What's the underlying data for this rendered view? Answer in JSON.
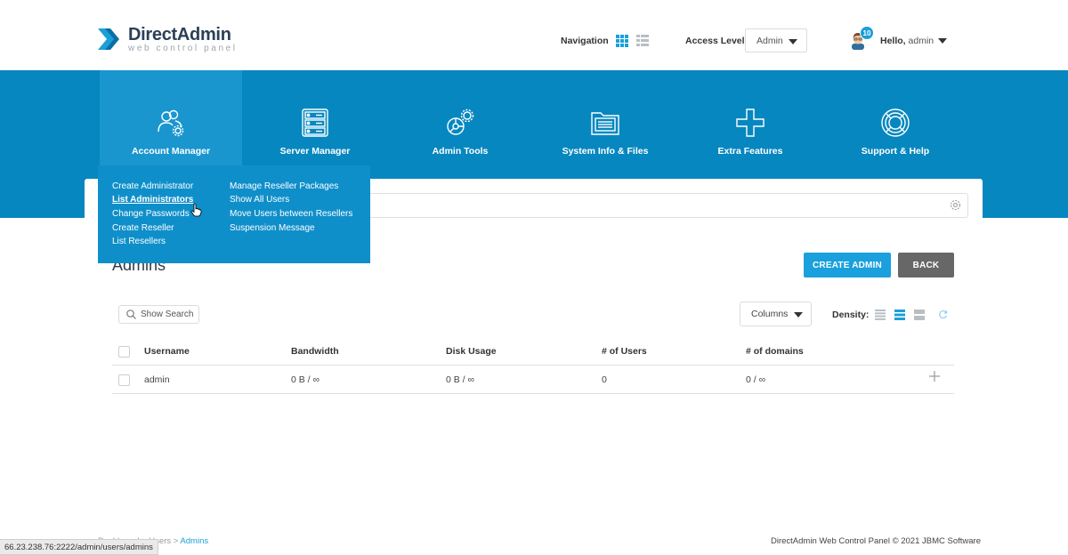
{
  "header": {
    "logo_name": "DirectAdmin",
    "logo_sub": "web control panel",
    "navigation_label": "Navigation",
    "access_level_label": "Access Level",
    "access_level_value": "Admin",
    "notifications_count": "10",
    "greeting_prefix": "Hello,",
    "greeting_user": "admin"
  },
  "main_menu": [
    {
      "label": "Account Manager",
      "icon": "users-gear-icon"
    },
    {
      "label": "Server Manager",
      "icon": "server-rack-icon"
    },
    {
      "label": "Admin Tools",
      "icon": "tools-gear-icon"
    },
    {
      "label": "System Info & Files",
      "icon": "folder-icon"
    },
    {
      "label": "Extra Features",
      "icon": "plus-icon"
    },
    {
      "label": "Support & Help",
      "icon": "lifebuoy-icon"
    }
  ],
  "dropdown": {
    "col1": [
      "Create Administrator",
      "List Administrators",
      "Change Passwords",
      "Create Reseller",
      "List Resellers"
    ],
    "col2": [
      "Manage Reseller Packages",
      "Show All Users",
      "Move Users between Resellers",
      "Suspension Message"
    ]
  },
  "page": {
    "title": "Admins",
    "create_button": "CREATE ADMIN",
    "back_button": "BACK",
    "show_search": "Show Search",
    "columns_button": "Columns",
    "density_label": "Density:"
  },
  "table": {
    "headers": [
      "Username",
      "Bandwidth",
      "Disk Usage",
      "# of Users",
      "# of domains"
    ],
    "rows": [
      [
        "admin",
        "0 B / ∞",
        "0 B / ∞",
        "0",
        "0 / ∞"
      ]
    ]
  },
  "footer": {
    "breadcrumb_hidden": "Dashboard > Users",
    "breadcrumb_current": "Admins",
    "copyright": "DirectAdmin Web Control Panel © 2021 JBMC Software"
  },
  "statusbar": {
    "url": "66.23.238.76:2222/admin/users/admins"
  },
  "colors": {
    "primary_blue": "#0787bf",
    "accent_blue": "#1aa0dc",
    "back_gray": "#676767"
  }
}
